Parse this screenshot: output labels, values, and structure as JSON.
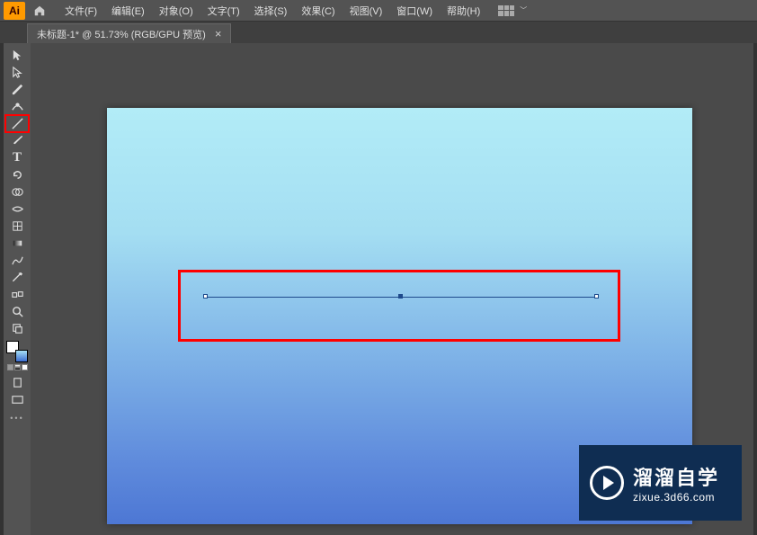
{
  "app": {
    "logo": "Ai"
  },
  "menubar": {
    "items": [
      {
        "label": "文件(F)"
      },
      {
        "label": "编辑(E)"
      },
      {
        "label": "对象(O)"
      },
      {
        "label": "文字(T)"
      },
      {
        "label": "选择(S)"
      },
      {
        "label": "效果(C)"
      },
      {
        "label": "视图(V)"
      },
      {
        "label": "窗口(W)"
      },
      {
        "label": "帮助(H)"
      }
    ]
  },
  "document": {
    "tab_label": "未标题-1* @ 51.73% (RGB/GPU 预览)",
    "close": "×"
  },
  "toolbar": {
    "tools": [
      {
        "name": "selection-tool",
        "icon": "selection"
      },
      {
        "name": "direct-selection-tool",
        "icon": "direct"
      },
      {
        "name": "pen-tool",
        "icon": "pen"
      },
      {
        "name": "curvature-tool",
        "icon": "curve"
      },
      {
        "name": "line-tool",
        "icon": "line",
        "highlighted": true
      },
      {
        "name": "paintbrush-tool",
        "icon": "brush"
      },
      {
        "name": "type-tool",
        "icon": "text"
      },
      {
        "name": "rotate-tool",
        "icon": "rotate"
      },
      {
        "name": "shape-builder-tool",
        "icon": "shapebuild"
      },
      {
        "name": "width-tool",
        "icon": "width"
      },
      {
        "name": "mesh-tool",
        "icon": "mesh"
      },
      {
        "name": "gradient-tool",
        "icon": "gradient"
      },
      {
        "name": "pencil-tool",
        "icon": "pencil"
      },
      {
        "name": "eyedropper-tool",
        "icon": "eyedrop"
      },
      {
        "name": "blend-tool",
        "icon": "blend"
      },
      {
        "name": "zoom-tool",
        "icon": "zoom"
      },
      {
        "name": "artboard-tool",
        "icon": "artboard"
      }
    ]
  },
  "colors": {
    "fill": "#ffffff",
    "stroke_gradient_start": "#a8e0f5",
    "stroke_gradient_end": "#3b6dd0",
    "highlight_red": "#ff0000",
    "canvas_gradient_top": "#b2ecf7",
    "canvas_gradient_bottom": "#4d77d4"
  },
  "watermark": {
    "title": "溜溜自学",
    "url": "zixue.3d66.com"
  },
  "tool_text": {
    "T": "T"
  }
}
